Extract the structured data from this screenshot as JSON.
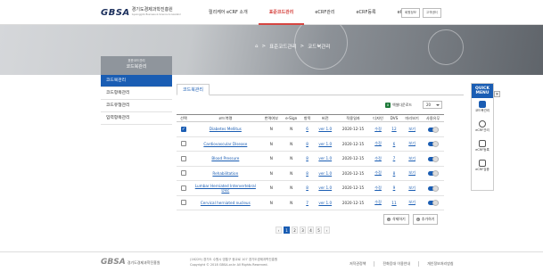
{
  "header": {
    "logo_mark": "GBSA",
    "logo_text": "경기도경제과학진흥원",
    "logo_sub": "Gyeonggido Business & Science Accelerator",
    "menu": [
      {
        "label": "릴리케어 eCRF 소개",
        "active": false
      },
      {
        "label": "표준코드관리",
        "active": true
      },
      {
        "label": "eCRF관리",
        "active": false
      },
      {
        "label": "eCRF등록",
        "active": false
      },
      {
        "label": "eCRF검증",
        "active": false
      }
    ],
    "util": [
      "회원정보",
      "고객센터"
    ]
  },
  "breadcrumb": {
    "home": "⌂",
    "sep": ">",
    "items": [
      "표준코드관리",
      "코드북관리"
    ]
  },
  "lnb": {
    "sub": "표준코드관리",
    "title": "코드북관리",
    "items": [
      {
        "label": "코드북관리",
        "active": true
      },
      {
        "label": "코드항목관리",
        "active": false
      },
      {
        "label": "코드유형관리",
        "active": false
      },
      {
        "label": "입력항목관리",
        "active": false
      }
    ]
  },
  "tab": {
    "label": "코드북관리"
  },
  "toolbar": {
    "excel_label": "엑셀다운로드",
    "page_size": "20"
  },
  "table": {
    "headers": [
      "선택",
      "코드북명",
      "번역여부",
      "e-Sign",
      "항목",
      "버전",
      "적용일자",
      "디자인",
      "DVS",
      "미리보기",
      "사용유무"
    ],
    "rows": [
      {
        "checked": true,
        "name": "Diabetes Mellitus",
        "translate": "N",
        "esign": "N",
        "items": "6",
        "version": "ver 1.0",
        "date": "2020-12-15",
        "design": "수정",
        "dvs": "12",
        "preview": "보기",
        "use": true
      },
      {
        "checked": false,
        "name": "Cardiovascular Disease",
        "translate": "N",
        "esign": "N",
        "items": "8",
        "version": "ver 1.0",
        "date": "2020-12-15",
        "design": "수정",
        "dvs": "6",
        "preview": "보기",
        "use": true
      },
      {
        "checked": false,
        "name": "Blood Pressure",
        "translate": "N",
        "esign": "N",
        "items": "8",
        "version": "ver 1.0",
        "date": "2020-12-15",
        "design": "수정",
        "dvs": "7",
        "preview": "보기",
        "use": true
      },
      {
        "checked": false,
        "name": "Rehabilitation",
        "translate": "N",
        "esign": "N",
        "items": "8",
        "version": "ver 1.0",
        "date": "2020-12-15",
        "design": "수정",
        "dvs": "8",
        "preview": "보기",
        "use": true
      },
      {
        "checked": false,
        "name": "Lumbar Herniated Intervertebral Disc",
        "translate": "N",
        "esign": "N",
        "items": "8",
        "version": "ver 1.0",
        "date": "2020-12-15",
        "design": "수정",
        "dvs": "9",
        "preview": "보기",
        "use": true
      },
      {
        "checked": false,
        "name": "Cervical herniated nucleus",
        "translate": "N",
        "esign": "N",
        "items": "7",
        "version": "ver 1.0",
        "date": "2020-12-15",
        "design": "수정",
        "dvs": "11",
        "preview": "보기",
        "use": true
      }
    ]
  },
  "actions": {
    "delete": "삭제하기",
    "add": "추가하기"
  },
  "pager": {
    "prev": "‹",
    "pages": [
      "1",
      "2",
      "3",
      "4",
      "5"
    ],
    "current": "1",
    "next": "›"
  },
  "quick": {
    "title_1": "QUICK",
    "title_2": "MENU",
    "close": "×",
    "items": [
      "코드북관리",
      "eCRF관리",
      "eCRF등록",
      "eCRF검증"
    ]
  },
  "footer": {
    "logo": "GBSA",
    "logo_text": "경기도경제과학진흥원",
    "address": "(16229) 경기도 수원시 영통구 광교로 107 경기도경제과학진흥원",
    "copyright": "Copyright © 2018 GBSA.or.kr All Rights Reserved.",
    "links": [
      "저작권정책",
      "전화응대 이용안내",
      "개인정보처리방침"
    ]
  },
  "colors": {
    "primary": "#1a5db3",
    "active_menu": "#d64541"
  }
}
